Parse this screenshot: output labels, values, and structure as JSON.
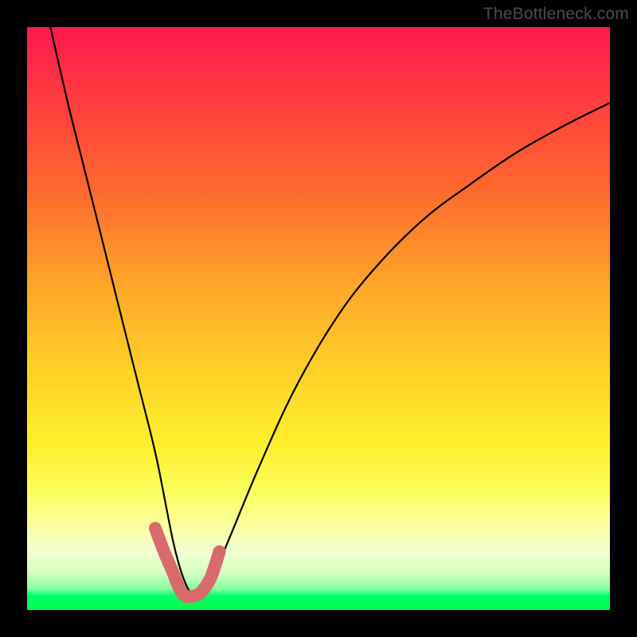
{
  "watermark": "TheBottleneck.com",
  "chart_data": {
    "type": "line",
    "title": "",
    "xlabel": "",
    "ylabel": "",
    "xlim": [
      0,
      100
    ],
    "ylim": [
      0,
      100
    ],
    "background": "rainbow_vertical_gradient",
    "series": [
      {
        "name": "curve",
        "color": "#000000",
        "x": [
          4,
          7,
          10,
          13,
          16,
          19,
          22,
          24,
          25,
          26,
          27,
          28,
          29,
          30,
          32,
          35,
          40,
          46,
          53,
          60,
          68,
          76,
          84,
          92,
          100
        ],
        "values": [
          100,
          87,
          75,
          63,
          51,
          39,
          27,
          17,
          12,
          8,
          5,
          3,
          2.5,
          3,
          6,
          13,
          25,
          38,
          50,
          59,
          67,
          73,
          78.5,
          83,
          87
        ]
      },
      {
        "name": "highlighted-zone",
        "color": "#d86a6a",
        "note": "thick pink segment around the curve minimum",
        "x": [
          22,
          23.5,
          25,
          26,
          27,
          28,
          29,
          30,
          31.5,
          33
        ],
        "values": [
          14,
          10,
          6.5,
          4,
          2.5,
          2.3,
          2.5,
          3.2,
          5.5,
          10
        ]
      }
    ]
  }
}
